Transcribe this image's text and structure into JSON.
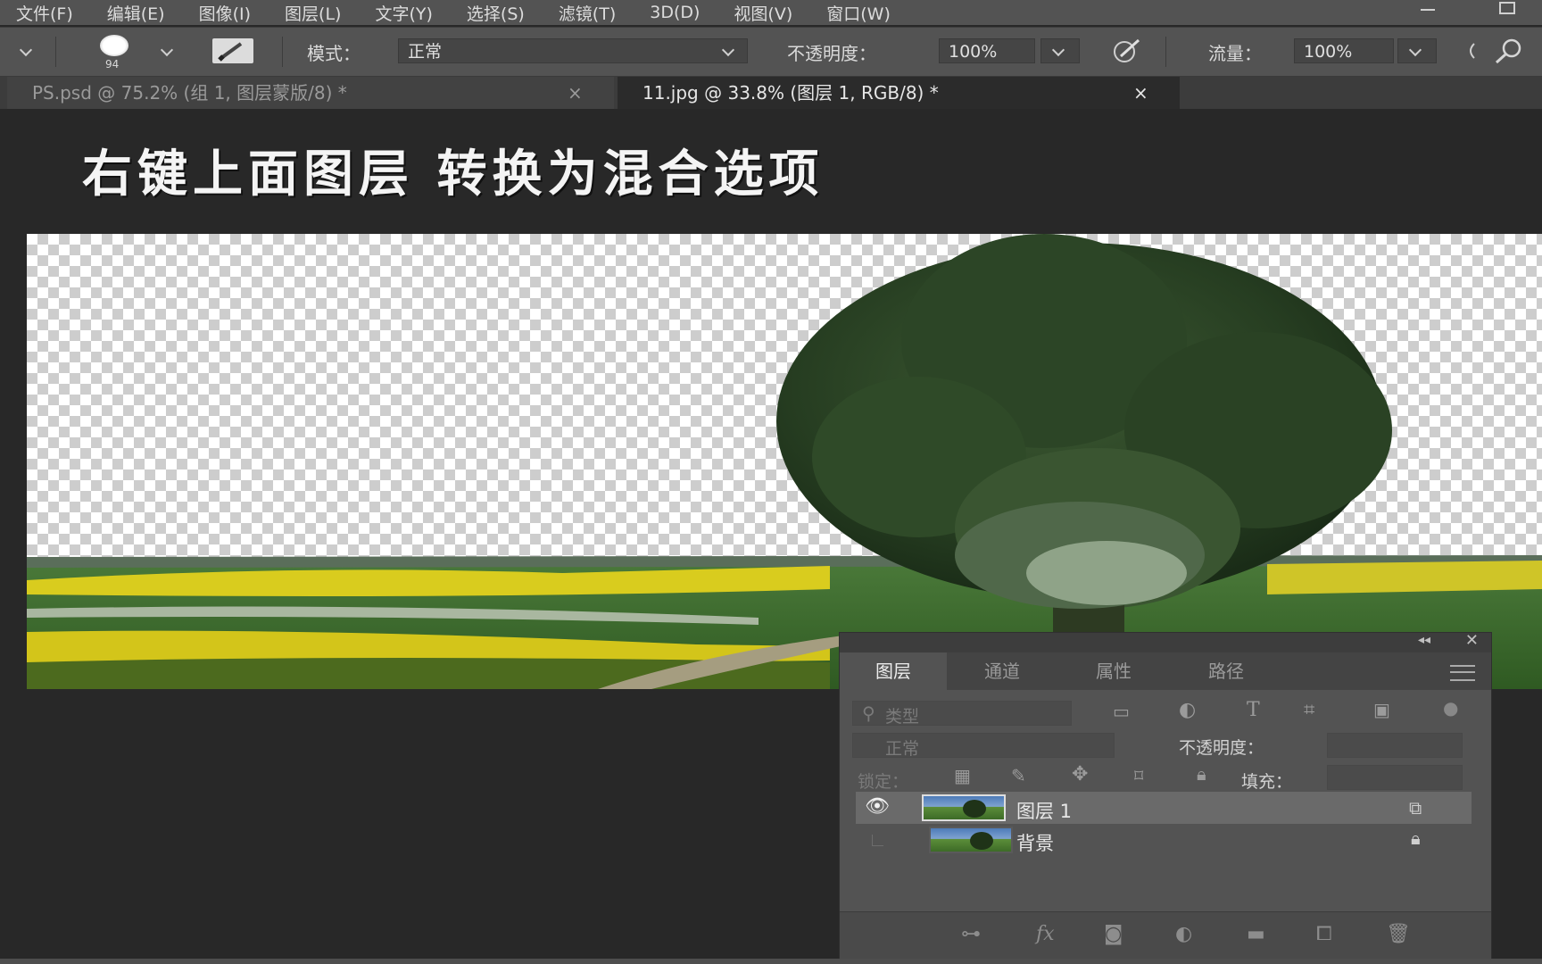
{
  "menu": {
    "items": [
      "文件(F)",
      "编辑(E)",
      "图像(I)",
      "图层(L)",
      "文字(Y)",
      "选择(S)",
      "滤镜(T)",
      "3D(D)",
      "视图(V)",
      "窗口(W)"
    ]
  },
  "options_bar": {
    "brush_size": "94",
    "mode_label": "模式：",
    "mode_value": "正常",
    "opacity_label": "不透明度：",
    "opacity_value": "100%",
    "flow_label": "流量：",
    "flow_value": "100%"
  },
  "tabs": [
    {
      "label": "PS.psd @ 75.2% (组 1, 图层蒙版/8) *",
      "active": false
    },
    {
      "label": "11.jpg @ 33.8% (图层 1, RGB/8) *",
      "active": true
    }
  ],
  "tab_close_glyph": "×",
  "caption": "右键上面图层 转换为混合选项",
  "layers_panel": {
    "tabs": [
      "图层",
      "通道",
      "属性",
      "路径"
    ],
    "active_tab": "图层",
    "filter_placeholder": "类型",
    "blend_mode": "正常",
    "opacity_label": "不透明度：",
    "lock_label": "锁定：",
    "fill_label": "填充：",
    "layers": [
      {
        "name": "图层 1",
        "visible": true,
        "selected": true,
        "locked": false
      },
      {
        "name": "背景",
        "visible": false,
        "selected": false,
        "locked": true
      }
    ]
  },
  "icons": {
    "tool_preset": "brush-dropdown-icon",
    "brush_toggle": "brush-settings-icon",
    "pressure_opacity": "pressure-pen-icon",
    "airbrush": "airbrush-icon",
    "search": "search-icon"
  }
}
